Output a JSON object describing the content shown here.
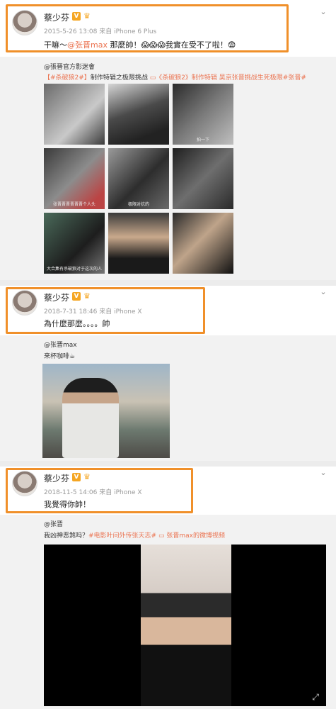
{
  "posts": [
    {
      "username": "蔡少芬",
      "meta": "2015-5-26 13:08 来自 iPhone 6 Plus",
      "content_prefix": "干嘛～",
      "content_mention": "@张晋max",
      "content_suffix": " 那麼帥！😱😱😱我實在受不了啦！😨",
      "repost": {
        "author": "@張晉官方影迷會",
        "text_tag1": "【#杀破狼2#】",
        "text_mid": "制作特辑之极限挑战 ",
        "text_tag2": "▭《杀破狼2》制作特辑 吴京张晋挑战生死极限",
        "text_tag3": "#张晋#",
        "captions": [
          "",
          "",
          "拍一下",
          "张晋晋晋晋晋晋个人头",
          "极限对抗的",
          "",
          "大合集有杀破狼对于这次的人",
          "",
          ""
        ]
      }
    },
    {
      "username": "蔡少芬",
      "meta": "2018-7-31 18:46 来自 iPhone X",
      "content": "為什麼那麼。。。。帥",
      "repost": {
        "author": "@张晋max",
        "text": "来杯咖啡☕"
      }
    },
    {
      "username": "蔡少芬",
      "meta": "2018-11-5 14:06 来自 iPhone X",
      "content": "我覺得你帥！",
      "repost": {
        "author": "@张晋",
        "text_prefix": "我凶神恶煞吗？",
        "text_tag1": "#电影叶问外传张天志#",
        "text_tag2": " ▭ 张晋max的微博视频"
      }
    }
  ],
  "icons": {
    "chevron": "chevron-down-icon",
    "verified": "v-badge-icon",
    "vip": "crown-icon",
    "fullscreen": "fullscreen-icon"
  },
  "colors": {
    "highlight": "#f0902a",
    "mention": "#eb7350",
    "repost_bg": "#f2f2f2"
  }
}
